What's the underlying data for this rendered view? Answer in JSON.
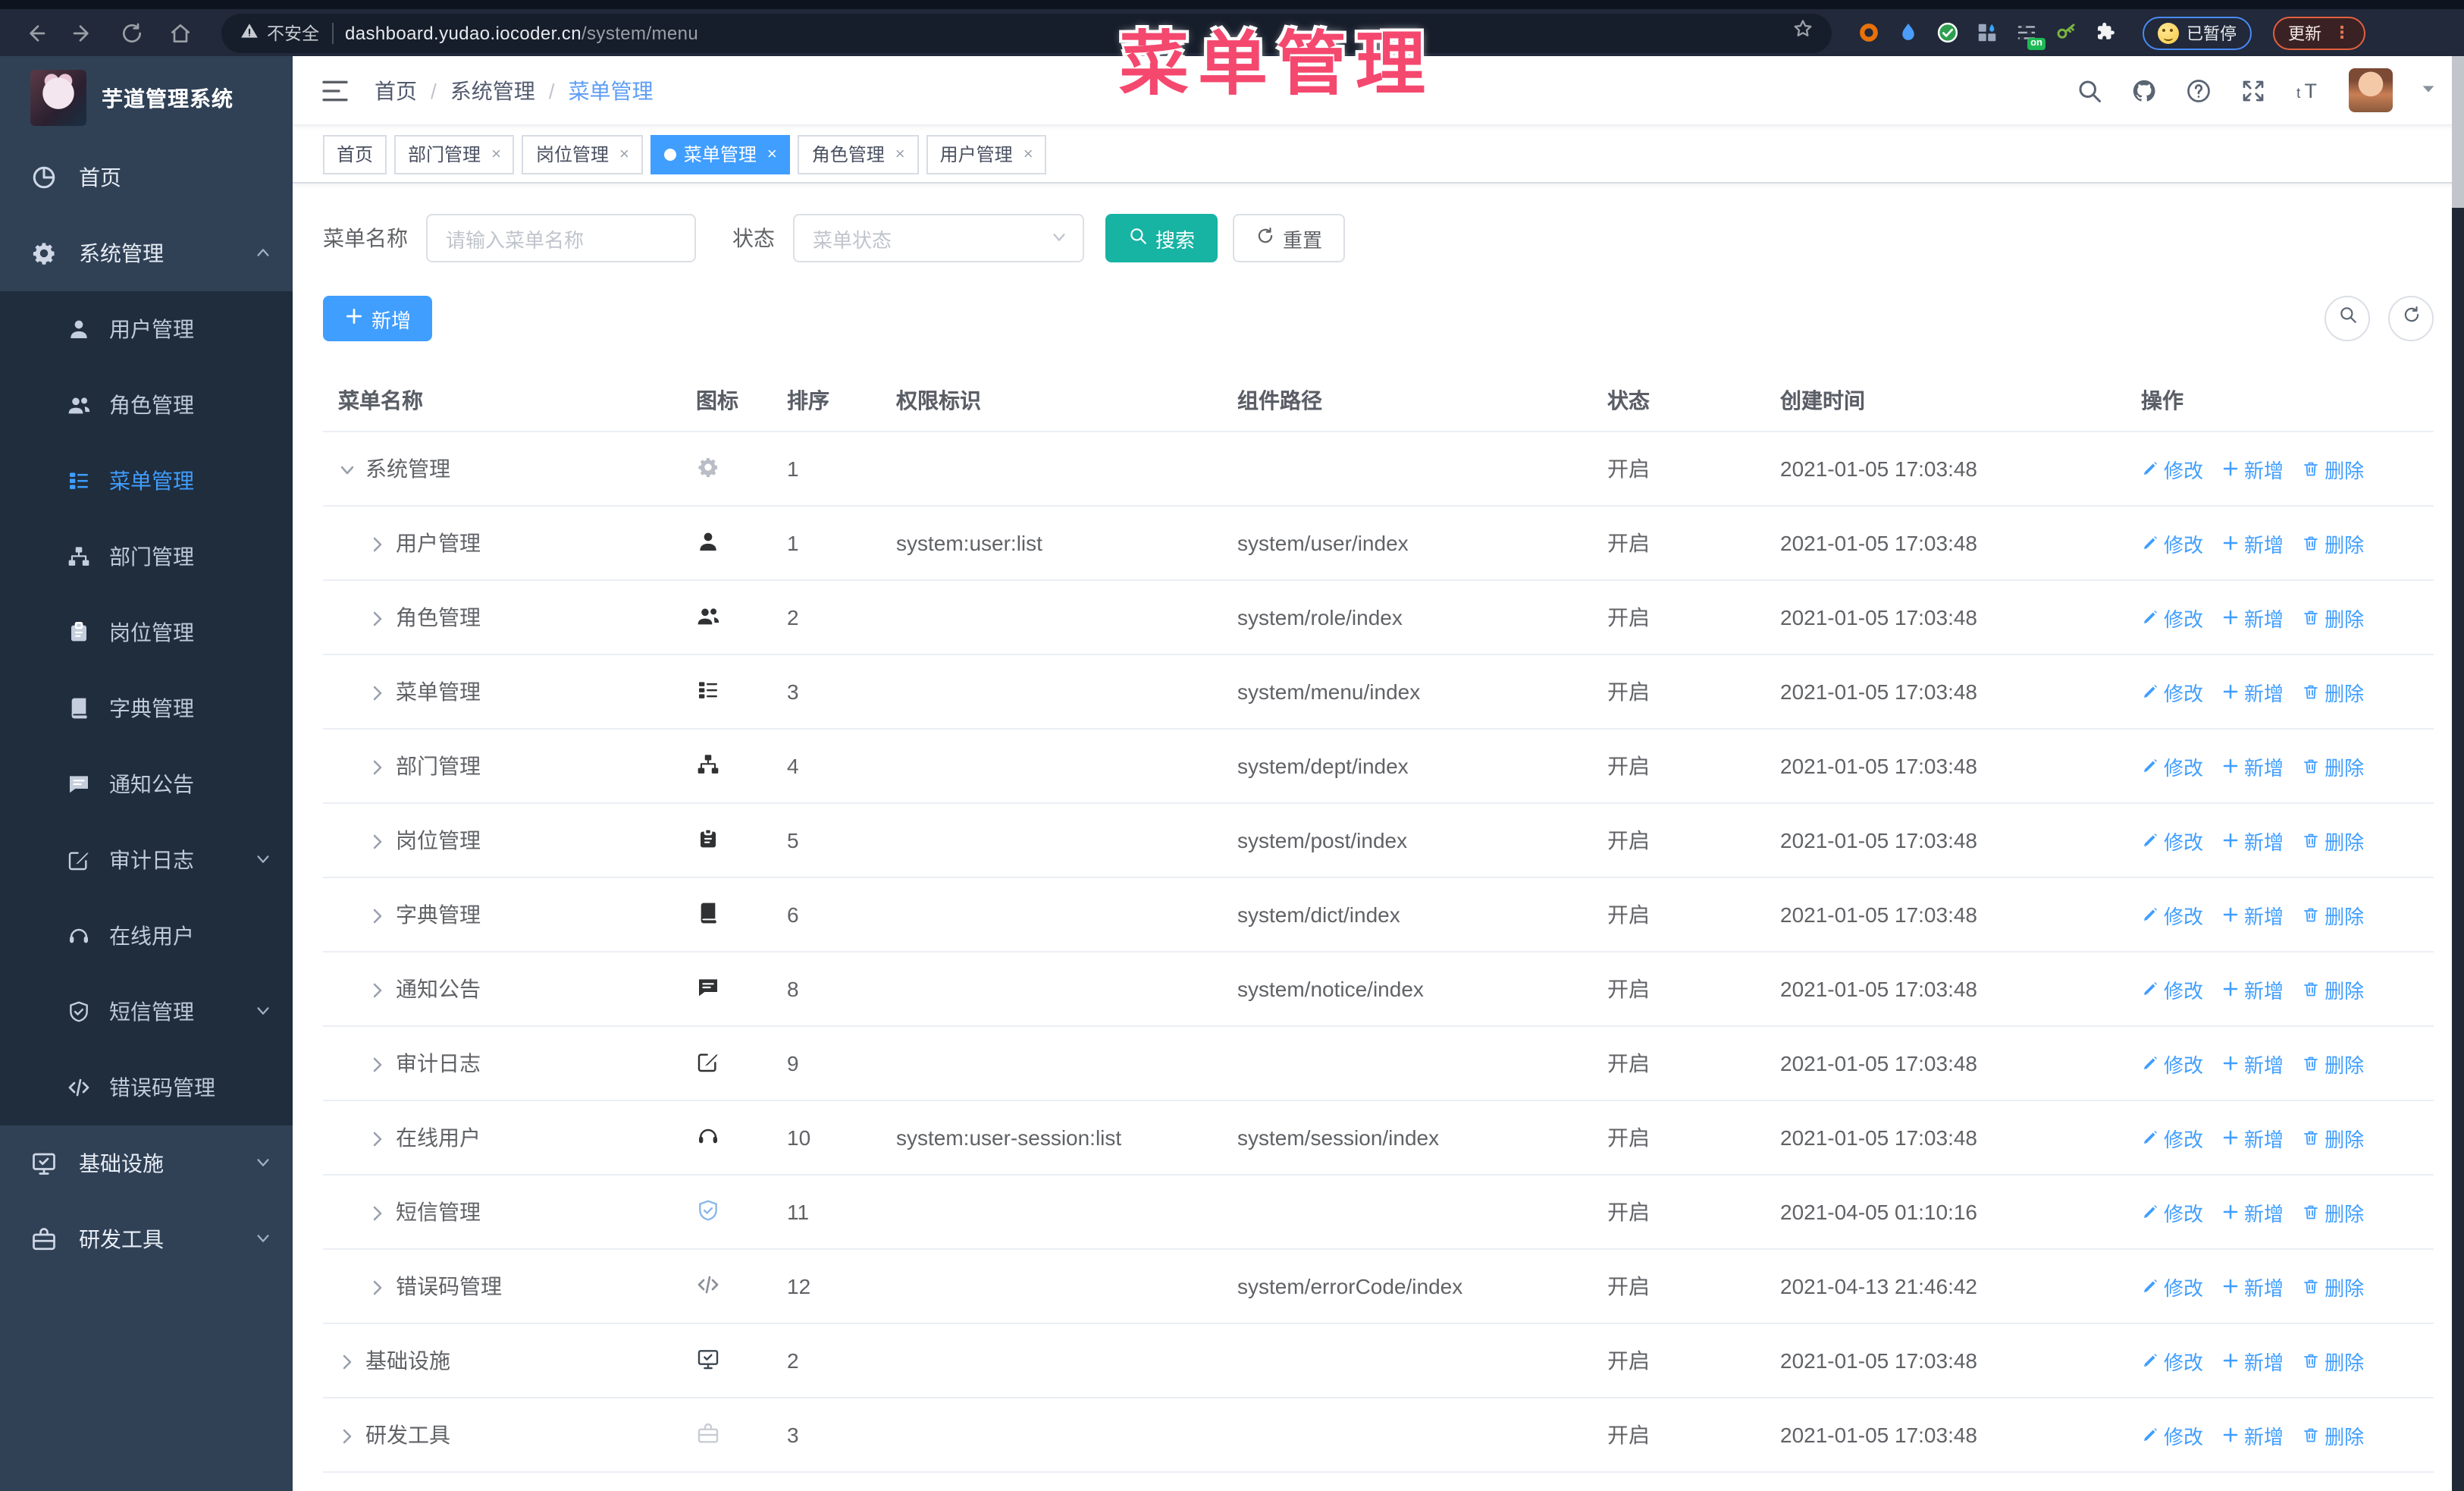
{
  "browser": {
    "security_label": "不安全",
    "url_host": "dashboard.yudao.iocoder.cn",
    "url_path": "/system/menu",
    "paused_badge": "已暂停",
    "update_button": "更新",
    "menu_dots": "⋮",
    "nav_icons": [
      "back-icon",
      "forward-icon",
      "reload-icon",
      "home-icon"
    ],
    "extensions": [
      "orange-ring",
      "blue-drop",
      "green-check",
      "blue-grid",
      "sliders-on",
      "green-key",
      "puzzle"
    ]
  },
  "annotation": {
    "title": "菜单管理",
    "color": "#F4486E"
  },
  "sidebar": {
    "logo_title": "芋道管理系统",
    "items": [
      {
        "label": "首页",
        "icon": "home",
        "level": 0
      },
      {
        "label": "系统管理",
        "icon": "gear",
        "level": 0,
        "chevron": "up"
      },
      {
        "label": "用户管理",
        "icon": "user",
        "level": 1
      },
      {
        "label": "角色管理",
        "icon": "peoples",
        "level": 1
      },
      {
        "label": "菜单管理",
        "icon": "tree-table",
        "level": 1,
        "active": true
      },
      {
        "label": "部门管理",
        "icon": "tree",
        "level": 1
      },
      {
        "label": "岗位管理",
        "icon": "post",
        "level": 1
      },
      {
        "label": "字典管理",
        "icon": "dict",
        "level": 1
      },
      {
        "label": "通知公告",
        "icon": "message",
        "level": 1
      },
      {
        "label": "审计日志",
        "icon": "edit",
        "level": 1,
        "chevron": "down"
      },
      {
        "label": "在线用户",
        "icon": "headset",
        "level": 1
      },
      {
        "label": "短信管理",
        "icon": "shield",
        "level": 1,
        "chevron": "down"
      },
      {
        "label": "错误码管理",
        "icon": "code",
        "level": 1
      },
      {
        "label": "基础设施",
        "icon": "monitor",
        "level": 0,
        "chevron": "down"
      },
      {
        "label": "研发工具",
        "icon": "box",
        "level": 0,
        "chevron": "down"
      }
    ]
  },
  "header": {
    "breadcrumb": [
      "首页",
      "系统管理",
      "菜单管理"
    ],
    "right_icons": [
      "search-icon",
      "github-icon",
      "question-icon",
      "fullscreen-icon",
      "fontsize-icon"
    ]
  },
  "tabs": [
    {
      "label": "首页",
      "closable": false,
      "active": false
    },
    {
      "label": "部门管理",
      "closable": true,
      "active": false
    },
    {
      "label": "岗位管理",
      "closable": true,
      "active": false
    },
    {
      "label": "菜单管理",
      "closable": true,
      "active": true
    },
    {
      "label": "角色管理",
      "closable": true,
      "active": false
    },
    {
      "label": "用户管理",
      "closable": true,
      "active": false
    }
  ],
  "filters": {
    "name_label": "菜单名称",
    "name_placeholder": "请输入菜单名称",
    "status_label": "状态",
    "status_placeholder": "菜单状态",
    "search_label": "搜索",
    "reset_label": "重置",
    "add_label": "新增"
  },
  "table": {
    "columns": [
      "菜单名称",
      "图标",
      "排序",
      "权限标识",
      "组件路径",
      "状态",
      "创建时间",
      "操作"
    ],
    "op_labels": {
      "edit": "修改",
      "add": "新增",
      "delete": "删除"
    },
    "rows": [
      {
        "name": "系统管理",
        "level": 0,
        "expanded": true,
        "icon": "gear",
        "icon_color": "#b9bdc6",
        "sort": "1",
        "perm": "",
        "path": "",
        "status": "开启",
        "time": "2021-01-05 17:03:48"
      },
      {
        "name": "用户管理",
        "level": 1,
        "expanded": false,
        "icon": "user",
        "icon_color": "#303133",
        "sort": "1",
        "perm": "system:user:list",
        "path": "system/user/index",
        "status": "开启",
        "time": "2021-01-05 17:03:48"
      },
      {
        "name": "角色管理",
        "level": 1,
        "expanded": false,
        "icon": "peoples",
        "icon_color": "#303133",
        "sort": "2",
        "perm": "",
        "path": "system/role/index",
        "status": "开启",
        "time": "2021-01-05 17:03:48"
      },
      {
        "name": "菜单管理",
        "level": 1,
        "expanded": false,
        "icon": "tree-table",
        "icon_color": "#303133",
        "sort": "3",
        "perm": "",
        "path": "system/menu/index",
        "status": "开启",
        "time": "2021-01-05 17:03:48"
      },
      {
        "name": "部门管理",
        "level": 1,
        "expanded": false,
        "icon": "tree",
        "icon_color": "#303133",
        "sort": "4",
        "perm": "",
        "path": "system/dept/index",
        "status": "开启",
        "time": "2021-01-05 17:03:48"
      },
      {
        "name": "岗位管理",
        "level": 1,
        "expanded": false,
        "icon": "post",
        "icon_color": "#303133",
        "sort": "5",
        "perm": "",
        "path": "system/post/index",
        "status": "开启",
        "time": "2021-01-05 17:03:48"
      },
      {
        "name": "字典管理",
        "level": 1,
        "expanded": false,
        "icon": "dict",
        "icon_color": "#303133",
        "sort": "6",
        "perm": "",
        "path": "system/dict/index",
        "status": "开启",
        "time": "2021-01-05 17:03:48"
      },
      {
        "name": "通知公告",
        "level": 1,
        "expanded": false,
        "icon": "message",
        "icon_color": "#303133",
        "sort": "8",
        "perm": "",
        "path": "system/notice/index",
        "status": "开启",
        "time": "2021-01-05 17:03:48"
      },
      {
        "name": "审计日志",
        "level": 1,
        "expanded": false,
        "icon": "edit",
        "icon_color": "#303133",
        "sort": "9",
        "perm": "",
        "path": "",
        "status": "开启",
        "time": "2021-01-05 17:03:48"
      },
      {
        "name": "在线用户",
        "level": 1,
        "expanded": false,
        "icon": "headset",
        "icon_color": "#303133",
        "sort": "10",
        "perm": "system:user-session:list",
        "path": "system/session/index",
        "status": "开启",
        "time": "2021-01-05 17:03:48"
      },
      {
        "name": "短信管理",
        "level": 1,
        "expanded": false,
        "icon": "shield",
        "icon_color": "#8ab8e8",
        "sort": "11",
        "perm": "",
        "path": "",
        "status": "开启",
        "time": "2021-04-05 01:10:16"
      },
      {
        "name": "错误码管理",
        "level": 1,
        "expanded": false,
        "icon": "code",
        "icon_color": "#8a9099",
        "sort": "12",
        "perm": "",
        "path": "system/errorCode/index",
        "status": "开启",
        "time": "2021-04-13 21:46:42"
      },
      {
        "name": "基础设施",
        "level": 0,
        "expanded": false,
        "icon": "monitor",
        "icon_color": "#3a4550",
        "sort": "2",
        "perm": "",
        "path": "",
        "status": "开启",
        "time": "2021-01-05 17:03:48"
      },
      {
        "name": "研发工具",
        "level": 0,
        "expanded": false,
        "icon": "box",
        "icon_color": "#c8ccd4",
        "sort": "3",
        "perm": "",
        "path": "",
        "status": "开启",
        "time": "2021-01-05 17:03:48"
      }
    ]
  },
  "colors": {
    "accent": "#409EFF",
    "search_button": "#17B3A3",
    "sidebar_bg": "#304156",
    "submenu_bg": "#1f2d3d",
    "annotation": "#F4486E",
    "tab_active_bg": "#409EFF"
  }
}
